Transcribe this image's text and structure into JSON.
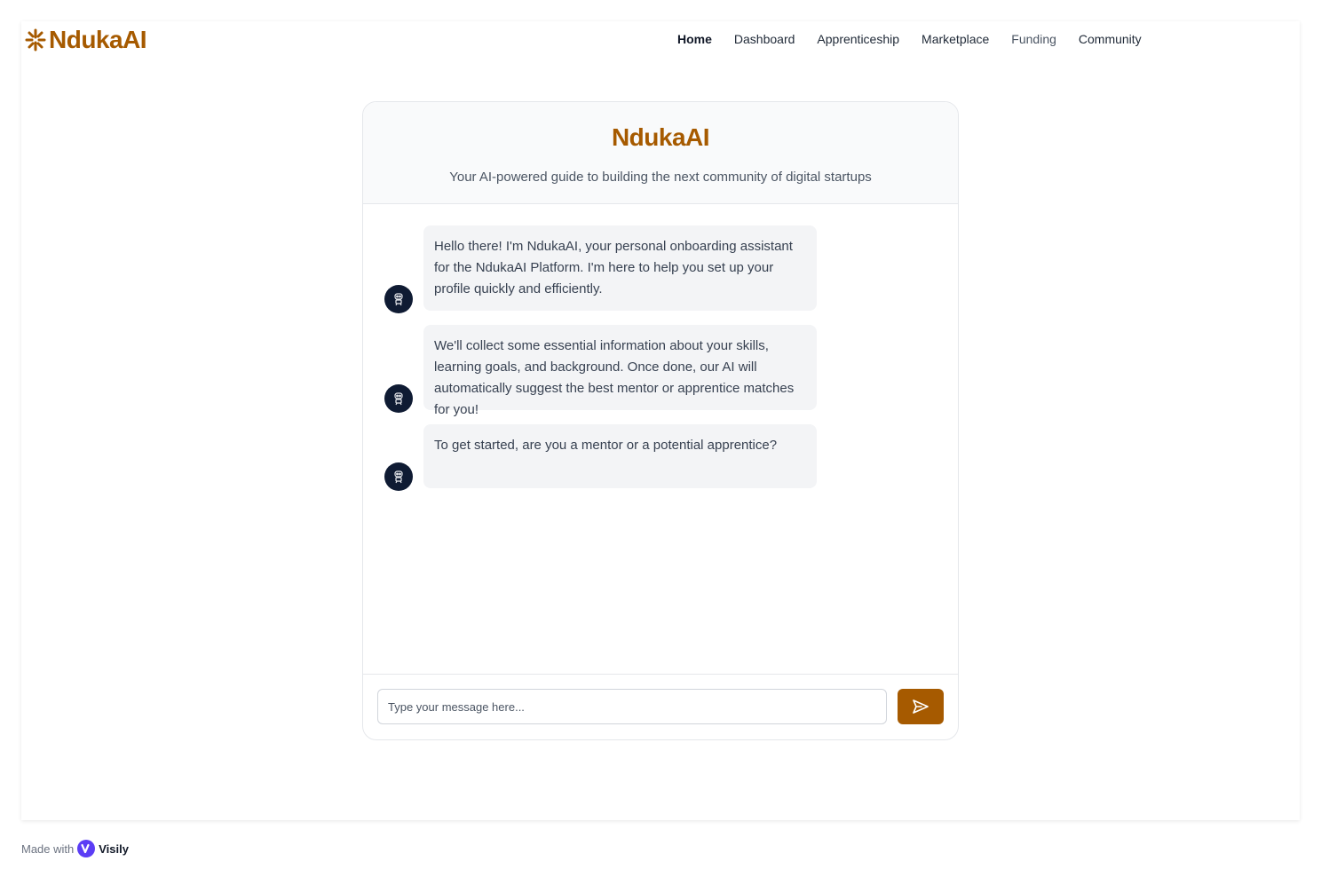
{
  "brand": {
    "name": "NdukaAI",
    "color": "#A65A00"
  },
  "nav": {
    "items": [
      {
        "label": "Home",
        "state": "active"
      },
      {
        "label": "Dashboard",
        "state": "default"
      },
      {
        "label": "Apprenticeship",
        "state": "default"
      },
      {
        "label": "Marketplace",
        "state": "default"
      },
      {
        "label": "Funding",
        "state": "muted"
      },
      {
        "label": "Community",
        "state": "default"
      }
    ]
  },
  "chat": {
    "title": "NdukaAI",
    "subtitle": "Your AI-powered guide to building the next community of digital startups",
    "messages": [
      {
        "sender": "bot",
        "avatar_icon": "robot-icon",
        "text": "Hello there! I'm NdukaAI, your personal onboarding assistant for the NdukaAI Platform. I'm here to help you set up your profile quickly and efficiently."
      },
      {
        "sender": "bot",
        "avatar_icon": "robot-icon",
        "text": "We'll collect some essential information about your skills, learning goals, and background. Once done, our AI will automatically suggest the best mentor or apprentice matches for you!"
      },
      {
        "sender": "bot",
        "avatar_icon": "robot-icon",
        "text": "To get started, are you a mentor or a potential apprentice?"
      }
    ],
    "input": {
      "placeholder": "Type your message here...",
      "value": ""
    },
    "send_icon": "send-icon"
  },
  "footer": {
    "made_with": "Made with",
    "tool": "Visily"
  }
}
